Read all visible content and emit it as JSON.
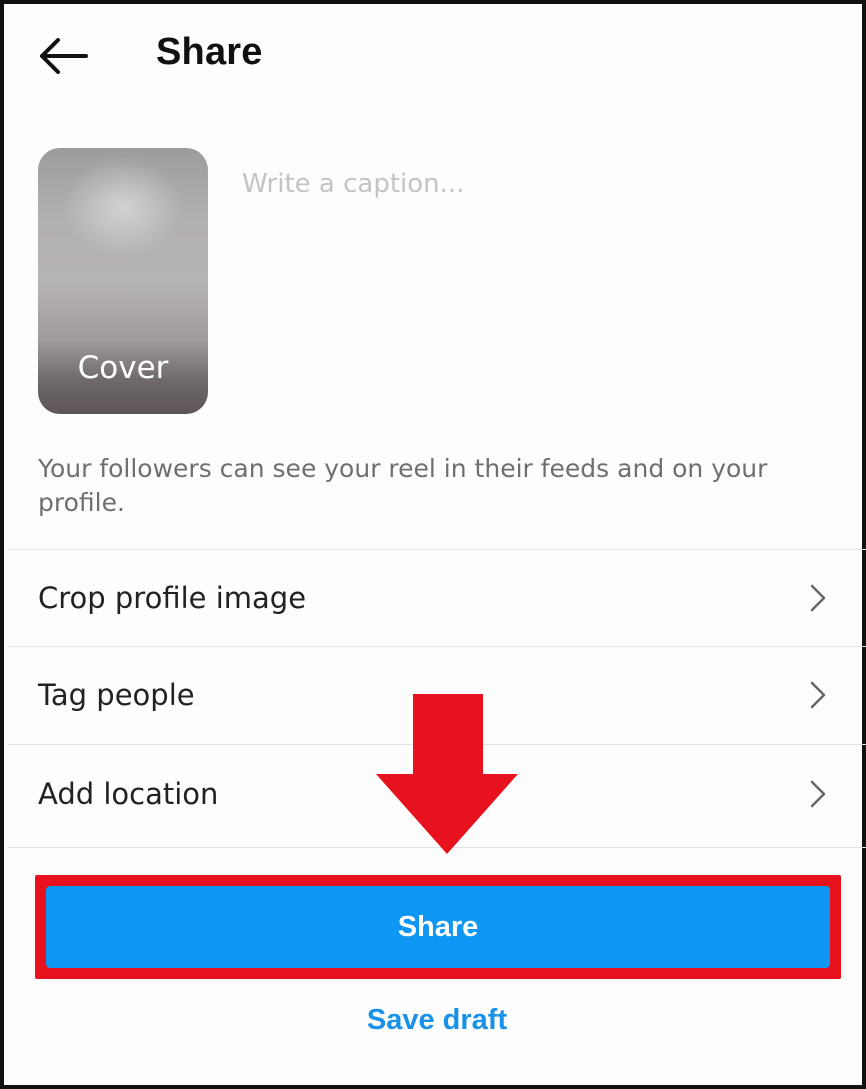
{
  "header": {
    "title": "Share",
    "back_icon": "arrow-left-icon"
  },
  "cover": {
    "label": "Cover"
  },
  "caption": {
    "placeholder": "Write a caption...",
    "value": ""
  },
  "info_text": "Your followers can see your reel in their feeds and on your profile.",
  "options": [
    {
      "label": "Crop profile image",
      "icon": "chevron-right-icon"
    },
    {
      "label": "Tag people",
      "icon": "chevron-right-icon"
    },
    {
      "label": "Add location",
      "icon": "chevron-right-icon"
    }
  ],
  "annotation": {
    "arrow_color": "#e8121f",
    "highlight_color": "#e8121f"
  },
  "actions": {
    "share_label": "Share",
    "save_draft_label": "Save draft"
  },
  "colors": {
    "primary": "#0d96f2",
    "link": "#1a91e8"
  }
}
